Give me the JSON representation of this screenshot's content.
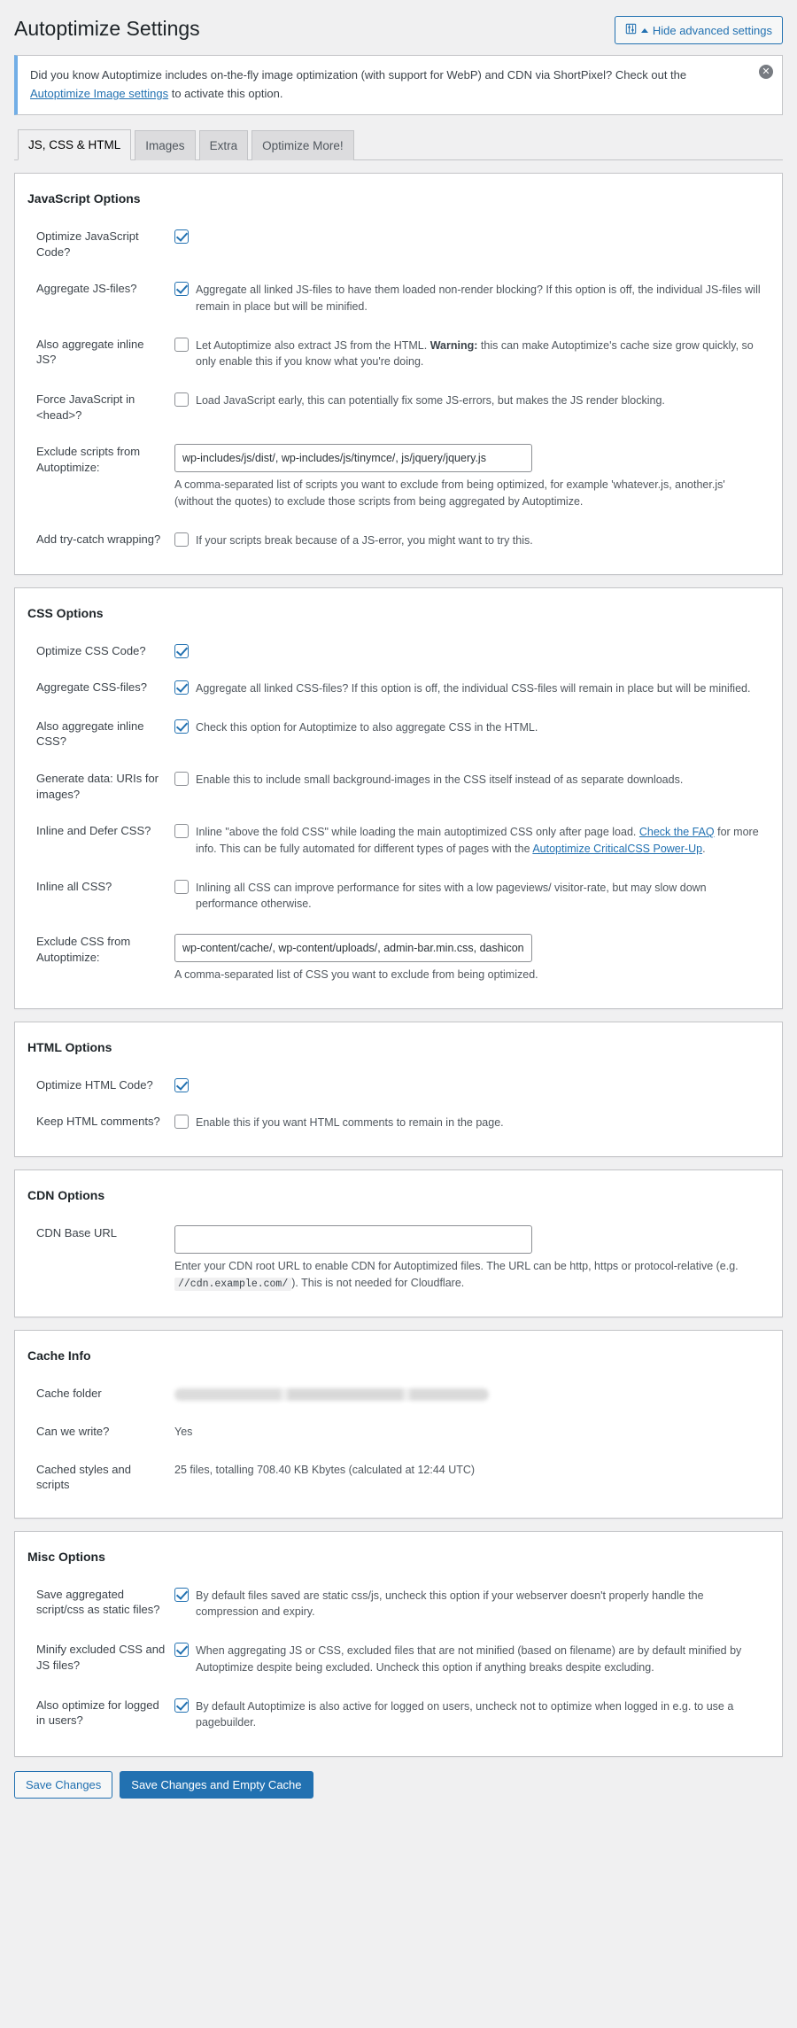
{
  "header": {
    "title": "Autoptimize Settings",
    "advanced_button": "Hide advanced settings",
    "advanced_icon": "sliders-icon",
    "caret_icon": "caret-up-icon"
  },
  "notice": {
    "text_before": "Did you know Autoptimize includes on-the-fly image optimization (with support for WebP) and CDN via ShortPixel? Check out the",
    "link": "Autoptimize Image settings",
    "text_after": "to activate this option.",
    "dismiss_icon": "close-icon",
    "accent_color": "#72aee6"
  },
  "tabs": [
    {
      "label": "JS, CSS & HTML",
      "active": true
    },
    {
      "label": "Images",
      "active": false
    },
    {
      "label": "Extra",
      "active": false
    },
    {
      "label": "Optimize More!",
      "active": false
    }
  ],
  "js_options": {
    "heading": "JavaScript Options",
    "rows": {
      "optimize": {
        "label": "Optimize JavaScript Code?",
        "checked": true,
        "text": ""
      },
      "aggregate": {
        "label": "Aggregate JS-files?",
        "checked": true,
        "text": "Aggregate all linked JS-files to have them loaded non-render blocking? If this option is off, the individual JS-files will remain in place but will be minified."
      },
      "inline": {
        "label": "Also aggregate inline JS?",
        "checked": false,
        "text_1": "Let Autoptimize also extract JS from the HTML.",
        "bold": "Warning:",
        "text_2": "this can make Autoptimize's cache size grow quickly, so only enable this if you know what you're doing."
      },
      "force_head": {
        "label": "Force JavaScript in <head>?",
        "checked": false,
        "text": "Load JavaScript early, this can potentially fix some JS-errors, but makes the JS render blocking."
      },
      "exclude": {
        "label": "Exclude scripts from Autoptimize:",
        "value": "wp-includes/js/dist/, wp-includes/js/tinymce/, js/jquery/jquery.js",
        "desc": "A comma-separated list of scripts you want to exclude from being optimized, for example 'whatever.js, another.js' (without the quotes) to exclude those scripts from being aggregated by Autoptimize."
      },
      "trycatch": {
        "label": "Add try-catch wrapping?",
        "checked": false,
        "text": "If your scripts break because of a JS-error, you might want to try this."
      }
    }
  },
  "css_options": {
    "heading": "CSS Options",
    "rows": {
      "optimize": {
        "label": "Optimize CSS Code?",
        "checked": true,
        "text": ""
      },
      "aggregate": {
        "label": "Aggregate CSS-files?",
        "checked": true,
        "text": "Aggregate all linked CSS-files? If this option is off, the individual CSS-files will remain in place but will be minified."
      },
      "inline": {
        "label": "Also aggregate inline CSS?",
        "checked": true,
        "text": "Check this option for Autoptimize to also aggregate CSS in the HTML."
      },
      "datauris": {
        "label": "Generate data: URIs for images?",
        "checked": false,
        "text": "Enable this to include small background-images in the CSS itself instead of as separate downloads."
      },
      "defer": {
        "label": "Inline and Defer CSS?",
        "checked": false,
        "text_1": "Inline \"above the fold CSS\" while loading the main autoptimized CSS only after page load.",
        "link_1": "Check the FAQ",
        "text_2": "for more info. This can be fully automated for different types of pages with the",
        "link_2": "Autoptimize CriticalCSS Power-Up",
        "text_3": "."
      },
      "inline_all": {
        "label": "Inline all CSS?",
        "checked": false,
        "text": "Inlining all CSS can improve performance for sites with a low pageviews/ visitor-rate, but may slow down performance otherwise."
      },
      "exclude": {
        "label": "Exclude CSS from Autoptimize:",
        "value": "wp-content/cache/, wp-content/uploads/, admin-bar.min.css, dashicons.min.css",
        "desc": "A comma-separated list of CSS you want to exclude from being optimized."
      }
    }
  },
  "html_options": {
    "heading": "HTML Options",
    "rows": {
      "optimize": {
        "label": "Optimize HTML Code?",
        "checked": true,
        "text": ""
      },
      "comments": {
        "label": "Keep HTML comments?",
        "checked": false,
        "text": "Enable this if you want HTML comments to remain in the page."
      }
    }
  },
  "cdn_options": {
    "heading": "CDN Options",
    "rows": {
      "base_url": {
        "label": "CDN Base URL",
        "value": "",
        "placeholder": "",
        "desc_1": "Enter your CDN root URL to enable CDN for Autoptimized files. The URL can be http, https or protocol-relative (e.g.",
        "code": "//cdn.example.com/",
        "desc_2": "). This is not needed for Cloudflare."
      }
    }
  },
  "cache_info": {
    "heading": "Cache Info",
    "rows": {
      "folder": {
        "label": "Cache folder",
        "value": "",
        "redacted": true
      },
      "writable": {
        "label": "Can we write?",
        "value": "Yes"
      },
      "cached": {
        "label": "Cached styles and scripts",
        "value": "25 files, totalling 708.40 KB Kbytes (calculated at 12:44 UTC)"
      }
    }
  },
  "misc_options": {
    "heading": "Misc Options",
    "rows": {
      "static": {
        "label": "Save aggregated script/css as static files?",
        "checked": true,
        "text": "By default files saved are static css/js, uncheck this option if your webserver doesn't properly handle the compression and expiry."
      },
      "minify_excluded": {
        "label": "Minify excluded CSS and JS files?",
        "checked": true,
        "text": "When aggregating JS or CSS, excluded files that are not minified (based on filename) are by default minified by Autoptimize despite being excluded. Uncheck this option if anything breaks despite excluding."
      },
      "logged_in": {
        "label": "Also optimize for logged in users?",
        "checked": true,
        "text": "By default Autoptimize is also active for logged on users, uncheck not to optimize when logged in e.g. to use a pagebuilder."
      }
    }
  },
  "submit": {
    "save": "Save Changes",
    "save_empty": "Save Changes and Empty Cache"
  },
  "colors": {
    "accent": "#2271b1",
    "notice_border": "#72aee6",
    "panel_border": "#c3c4c7",
    "page_bg": "#f0f0f1"
  }
}
